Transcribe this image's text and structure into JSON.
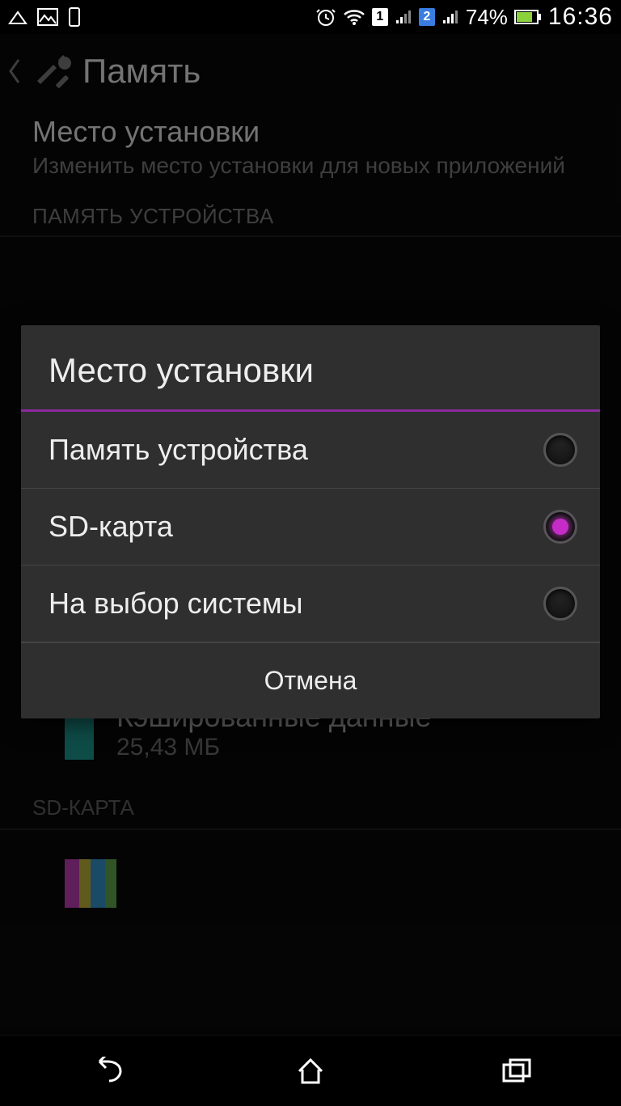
{
  "status": {
    "battery_percent_text": "74%",
    "clock": "16:36",
    "sim1_label": "1",
    "sim2_label": "2"
  },
  "header": {
    "title": "Память"
  },
  "install_location": {
    "title": "Место установки",
    "subtitle": "Изменить место установки для новых приложений"
  },
  "section_device_memory": "ПАМЯТЬ УСТРОЙСТВА",
  "cached": {
    "title": "Кэшированные данные",
    "value": "25,43 МБ"
  },
  "section_sd": "SD-КАРТА",
  "dialog": {
    "title": "Место установки",
    "options": [
      {
        "label": "Память устройства",
        "selected": false
      },
      {
        "label": "SD-карта",
        "selected": true
      },
      {
        "label": "На выбор системы",
        "selected": false
      }
    ],
    "cancel_label": "Отмена"
  }
}
